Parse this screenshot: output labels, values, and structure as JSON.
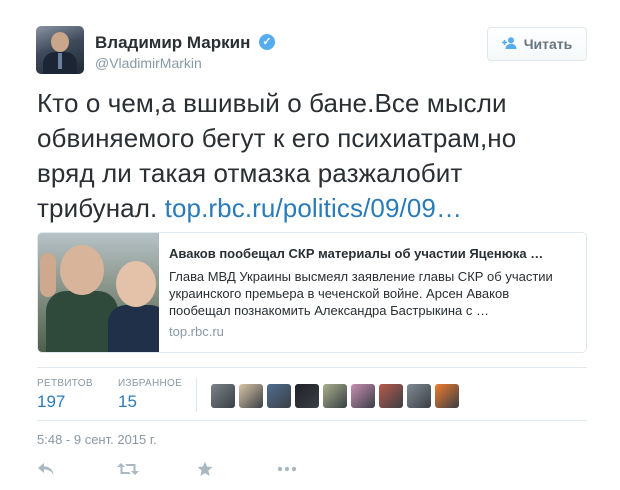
{
  "author": {
    "name": "Владимир Маркин",
    "handle": "@VladimirMarkin",
    "verified_icon": "verified-badge-icon"
  },
  "follow_button": {
    "label": "Читать",
    "icon": "add-user-icon"
  },
  "tweet": {
    "text_lines": [
      "Кто о чем,а вшивый о бане.Все мысли",
      "обвиняемого бегут к его психиатрам,но",
      "вряд ли такая отмазка разжалобит"
    ],
    "text_last": "трибунал.",
    "link": "top.rbc.ru/politics/09/09…"
  },
  "card": {
    "title": "Аваков пообещал СКР материалы об участии Яценюка …",
    "description": "Глава МВД Украины высмеял заявление главы СКР об участии украинского премьера в чеченской войне. Арсен Аваков пообещал познакомить Александра Бастрыкина с …",
    "domain": "top.rbc.ru"
  },
  "stats": {
    "retweets_label": "РЕТВИТОВ",
    "retweets_value": "197",
    "favorites_label": "ИЗБРАННОЕ",
    "favorites_value": "15"
  },
  "favoriter_avatar_colors": [
    "#7c8288",
    "#d9c7a7",
    "#4f6d8f",
    "#1f2227",
    "#a9b08a",
    "#c98fb3",
    "#b85a4a",
    "#808b95",
    "#f07c2e"
  ],
  "timestamp": "5:48 - 9 сент. 2015 г.",
  "actions": [
    "reply-icon",
    "retweet-icon",
    "favorite-icon",
    "more-icon"
  ],
  "colors": {
    "link": "#2b7bb9",
    "muted": "#8899a6",
    "verified": "#55acee"
  }
}
